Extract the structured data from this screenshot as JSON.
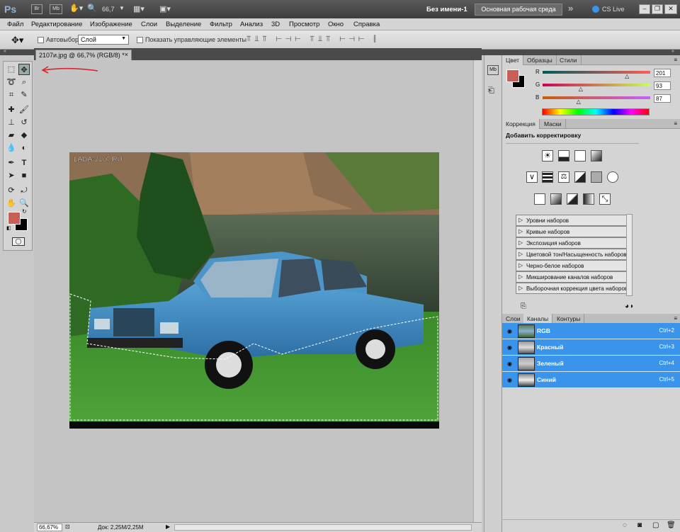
{
  "app": {
    "logo": "Ps",
    "zoom_level": "66,7",
    "doc_title": "Без имени-1",
    "workspace_button": "Основная рабочая среда",
    "cs_live": "CS Live",
    "overflow": "»"
  },
  "menu": [
    "Файл",
    "Редактирование",
    "Изображение",
    "Слои",
    "Выделение",
    "Фильтр",
    "Анализ",
    "3D",
    "Просмотр",
    "Окно",
    "Справка"
  ],
  "options": {
    "autoselect_label": "Автовыбор:",
    "autoselect_value": "Слой",
    "show_controls_label": "Показать управляющие элементы"
  },
  "document": {
    "tab_label": "2107и.jpg @ 66,7% (RGB/8) *",
    "image_watermark": "LADA-2107.RU"
  },
  "status": {
    "zoom": "66,67%",
    "doc_size": "Док: 2,25M/2,25M"
  },
  "color_panel": {
    "tabs": [
      "Цвет",
      "Образцы",
      "Стили"
    ],
    "channels": [
      {
        "label": "R",
        "value": "201",
        "fraction": 0.79
      },
      {
        "label": "G",
        "value": "93",
        "fraction": 0.36
      },
      {
        "label": "B",
        "value": "87",
        "fraction": 0.34
      }
    ],
    "foreground": "#c95d57",
    "background": "#000000"
  },
  "adjust_panel": {
    "tabs": [
      "Коррекция",
      "Маски"
    ],
    "heading": "Добавить корректировку",
    "presets": [
      "Уровни наборов",
      "Кривые наборов",
      "Экспозиция наборов",
      "Цветовой тон/Насыщенность наборов",
      "Черно-белое наборов",
      "Микширование каналов наборов",
      "Выборочная коррекция цвета наборов"
    ]
  },
  "channels_panel": {
    "tabs": [
      "Слои",
      "Каналы",
      "Контуры"
    ],
    "rows": [
      {
        "name": "RGB",
        "shortcut": "Ctrl+2"
      },
      {
        "name": "Красный",
        "shortcut": "Ctrl+3"
      },
      {
        "name": "Зеленый",
        "shortcut": "Ctrl+4"
      },
      {
        "name": "Синий",
        "shortcut": "Ctrl+5"
      }
    ]
  },
  "colors": {
    "accent_blue": "#3a94ec",
    "red_arrow": "#d42a2a",
    "workspace_btn": "#6a6a6a"
  }
}
